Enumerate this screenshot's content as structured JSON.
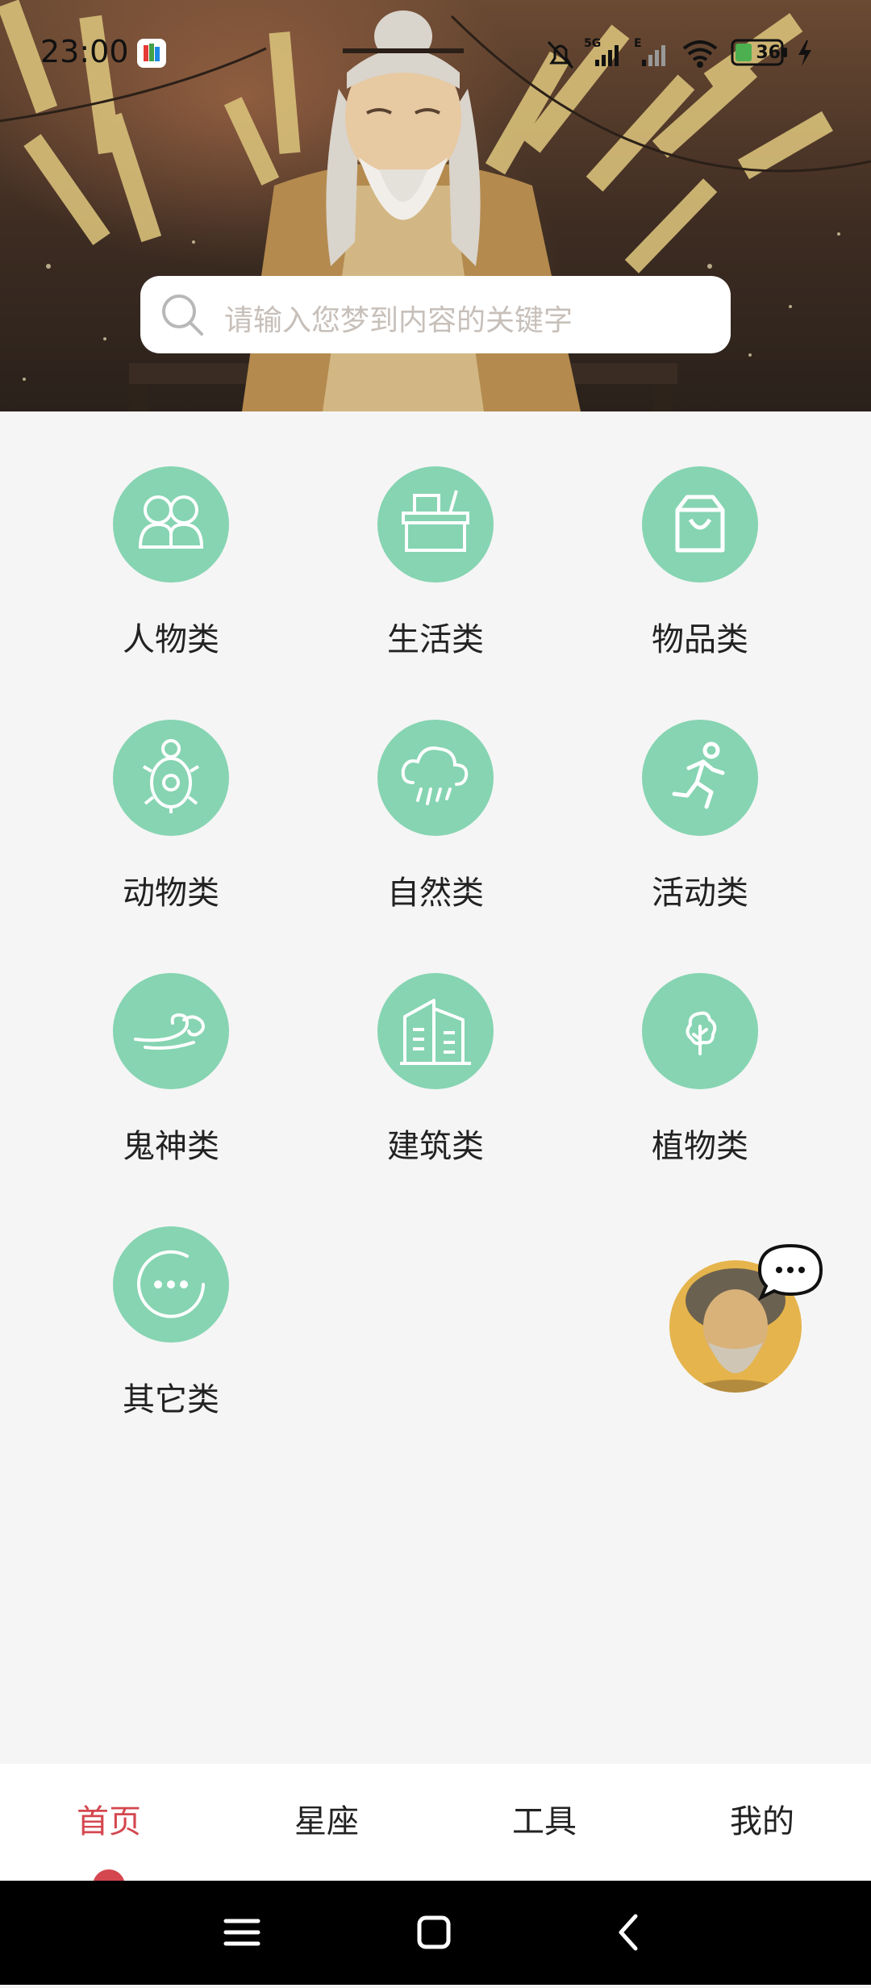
{
  "status_bar": {
    "time": "23:00",
    "battery_level": "36",
    "icons": [
      "app-notification-icon",
      "mute-bell-icon",
      "signal-5g-icon",
      "signal-e-icon",
      "wifi-icon",
      "battery-icon",
      "charging-icon"
    ]
  },
  "search": {
    "placeholder": "请输入您梦到内容的关键字",
    "icon": "search-icon"
  },
  "categories": [
    {
      "label": "人物类",
      "icon": "people-icon"
    },
    {
      "label": "生活类",
      "icon": "life-box-icon"
    },
    {
      "label": "物品类",
      "icon": "bag-icon"
    },
    {
      "label": "动物类",
      "icon": "turtle-icon"
    },
    {
      "label": "自然类",
      "icon": "rain-cloud-icon"
    },
    {
      "label": "活动类",
      "icon": "running-icon"
    },
    {
      "label": "鬼神类",
      "icon": "cloud-spirit-icon"
    },
    {
      "label": "建筑类",
      "icon": "building-icon"
    },
    {
      "label": "植物类",
      "icon": "tree-icon"
    },
    {
      "label": "其它类",
      "icon": "more-icon"
    }
  ],
  "assistant": {
    "icon": "chat-assistant-icon"
  },
  "bottom_nav": {
    "items": [
      {
        "label": "首页",
        "active": true
      },
      {
        "label": "星座",
        "active": false
      },
      {
        "label": "工具",
        "active": false
      },
      {
        "label": "我的",
        "active": false
      }
    ]
  },
  "colors": {
    "accent_green": "#86d4b2",
    "active_red": "#d4474f",
    "background": "#f5f5f5"
  }
}
